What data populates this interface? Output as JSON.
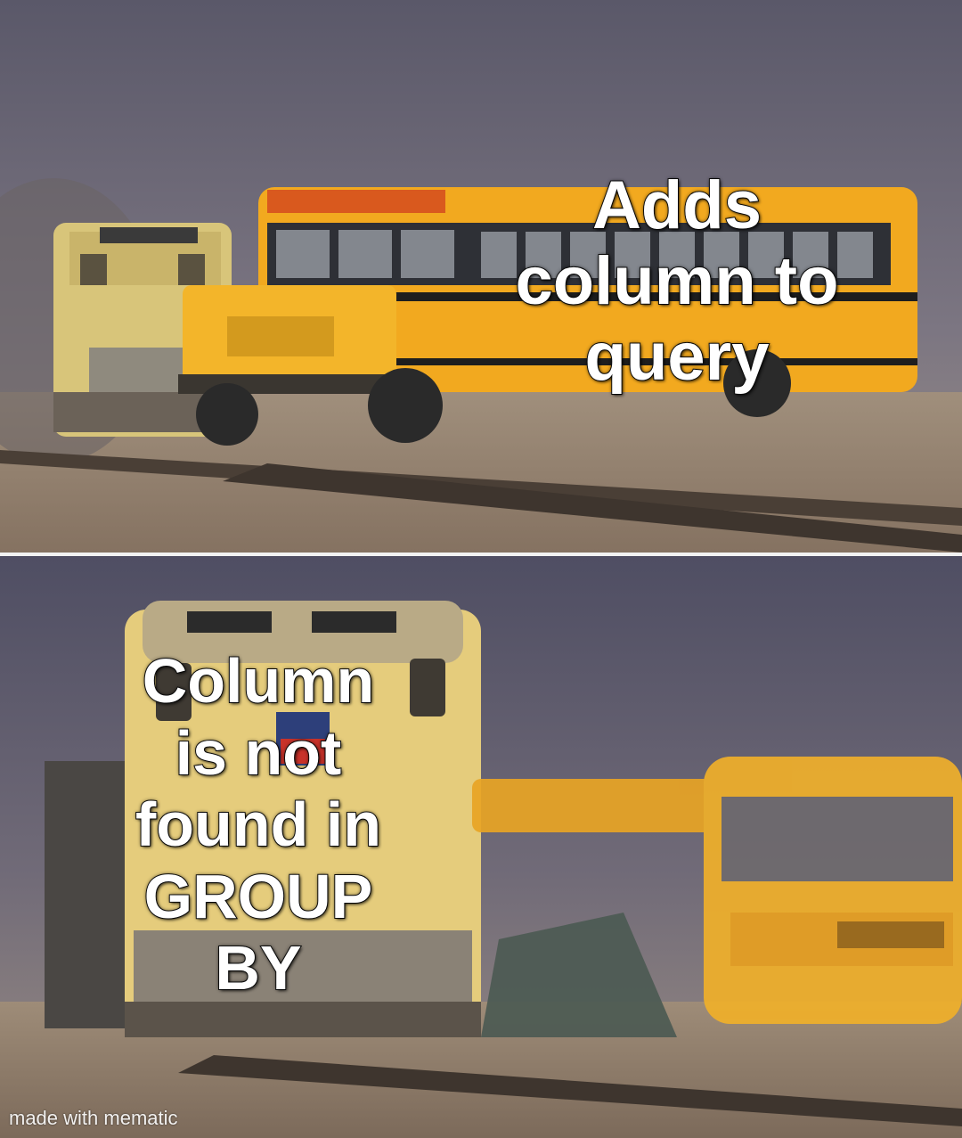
{
  "top_panel": {
    "caption_lines": [
      "Adds",
      "column to",
      "query"
    ]
  },
  "bottom_panel": {
    "caption_lines": [
      "Column",
      "is not",
      "found in",
      "GROUP",
      "BY"
    ]
  },
  "watermark": "made with mematic",
  "colors": {
    "sky": "#5d5a6a",
    "ground": "#8a7a66",
    "bus_yellow": "#f0a81e",
    "train_yellow": "#e8cf7a"
  }
}
